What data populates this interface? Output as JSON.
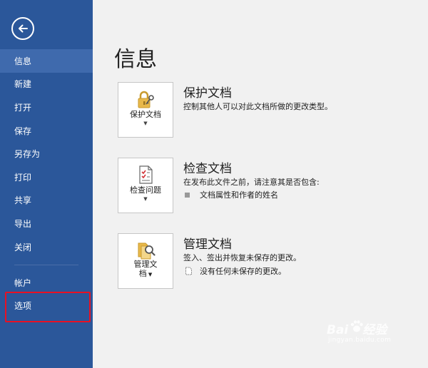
{
  "sidebar": {
    "back_icon": "back-arrow-icon",
    "items": [
      {
        "label": "信息",
        "active": true
      },
      {
        "label": "新建"
      },
      {
        "label": "打开"
      },
      {
        "label": "保存"
      },
      {
        "label": "另存为"
      },
      {
        "label": "打印"
      },
      {
        "label": "共享"
      },
      {
        "label": "导出"
      },
      {
        "label": "关闭"
      }
    ],
    "bottom_items": [
      {
        "label": "帐户"
      },
      {
        "label": "选项",
        "highlighted": true
      }
    ],
    "colors": {
      "background": "#2b579a",
      "active": "#3f6aad",
      "highlight_border": "#e81123"
    }
  },
  "main": {
    "title": "信息",
    "sections": [
      {
        "button_label": "保护文档",
        "icon": "lock-key-icon",
        "title": "保护文档",
        "description": "控制其他人可以对此文档所做的更改类型。"
      },
      {
        "button_label": "检查问题",
        "icon": "checklist-document-icon",
        "title": "检查文档",
        "description": "在发布此文件之前，请注意其是否包含:",
        "bullets": [
          "文档属性和作者的姓名"
        ]
      },
      {
        "button_label_line1": "管理文",
        "button_label_line2": "档",
        "icon": "document-search-icon",
        "title": "管理文档",
        "description": "签入、签出并恢复未保存的更改。",
        "bullets": [
          "没有任何未保存的更改。"
        ]
      }
    ]
  },
  "watermark": {
    "brand": "Bai",
    "brand2": "经验",
    "url": "jingyan.baidu.com"
  }
}
